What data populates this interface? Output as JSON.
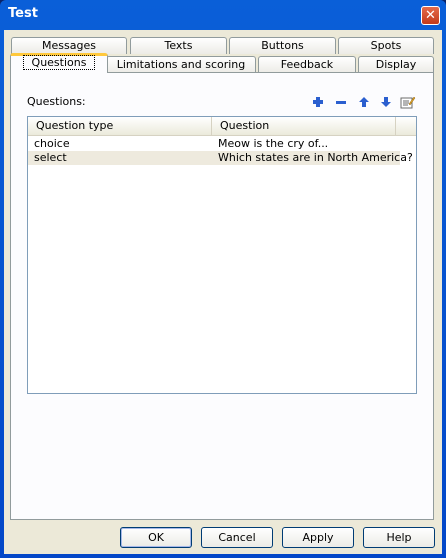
{
  "window": {
    "title": "Test"
  },
  "tabs": {
    "row1": [
      "Messages",
      "Texts",
      "Buttons",
      "Spots"
    ],
    "row2": [
      "Questions",
      "Limitations and scoring",
      "Feedback",
      "Display"
    ],
    "active": "Questions"
  },
  "questions_panel": {
    "label": "Questions:",
    "toolbar_icons": [
      "add-icon",
      "remove-icon",
      "move-up-icon",
      "move-down-icon",
      "edit-icon"
    ],
    "columns": [
      "Question type",
      "Question"
    ],
    "rows": [
      {
        "type": "choice",
        "question": "Meow is the cry of..."
      },
      {
        "type": "select",
        "question": "Which states are in North America?"
      }
    ],
    "selected_row": 1
  },
  "buttons": {
    "ok": "OK",
    "cancel": "Cancel",
    "apply": "Apply",
    "help": "Help"
  },
  "colors": {
    "title_bar": "#0a5fd8",
    "close_button": "#d9532f",
    "face": "#ece9d8",
    "active_tab_accent": "#ffc83c",
    "selected_row": "#eeeade"
  }
}
